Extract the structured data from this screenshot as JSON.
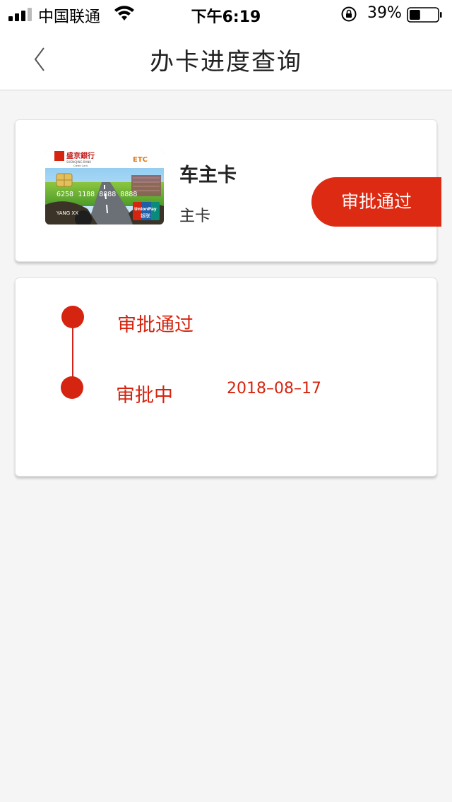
{
  "status_bar": {
    "carrier": "中国联通",
    "time": "下午6:19",
    "battery": "39%",
    "battery_level": 0.39,
    "icons": [
      "signal-icon",
      "wifi-icon",
      "rotation-lock-icon",
      "battery-icon"
    ]
  },
  "nav": {
    "title": "办卡进度查询",
    "back_icon": "chevron-left-icon"
  },
  "card": {
    "name": "车主卡",
    "type": "主卡",
    "status": "审批通过",
    "image": {
      "bank_name": "盛京銀行",
      "bank_en": "SHENGJING BANK",
      "sub": "Credit Card",
      "tag": "ETC",
      "number": "6258 1188 8888 8888",
      "holder": "YANG XX",
      "network": "UnionPay",
      "network_cn": "银联"
    }
  },
  "timeline": {
    "steps": [
      {
        "label": "审批通过",
        "date": ""
      },
      {
        "label": "审批中",
        "date": "2018–08–17"
      }
    ]
  },
  "colors": {
    "accent": "#dd2a12",
    "background": "#f5f5f5"
  }
}
